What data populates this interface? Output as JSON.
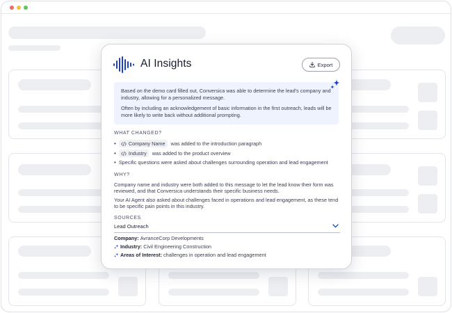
{
  "insights": {
    "title": "AI Insights",
    "export_label": "Export",
    "summary": [
      "Based on the demo card filled out, Conversica was able to determine the lead’s company and industry, allowing for a personalized message.",
      "Often by including an acknowledgement of basic information in the first outreach, leads will be more likely to write back without additional prompting."
    ],
    "what_changed_heading": "WHAT CHANGED?",
    "changes": [
      {
        "chip": "Company Name",
        "text": "was added to the introduction paragraph"
      },
      {
        "chip": "Industry",
        "text": "was added to the product overview"
      },
      {
        "chip": "",
        "text": "Specific questions were asked about challenges surrounding operation and lead engagement"
      }
    ],
    "why_heading": "WHY?",
    "why_paragraphs": [
      "Company name and industry were both added to this message to let the lead know their form was reviewed, and that Conversica understands their specific business needs.",
      "Your AI Agent also asked about challenges faced in operations and lead engagement, as these tend to be specific pain points in this industry."
    ],
    "sources_heading": "SOURCES",
    "sources_dropdown": "Lead Outreach",
    "sources": [
      {
        "label": "Company:",
        "value": "AvranceCorp Developments",
        "icon": ""
      },
      {
        "label": "Industry:",
        "value": "Civil Engineering Construction",
        "icon": "sparkle-icon"
      },
      {
        "label": "Areas of Interest:",
        "value": "challenges in operation and lead engagement",
        "icon": "sparkle-icon"
      }
    ]
  },
  "colors": {
    "accent": "#1c3fc9",
    "summary_bg": "#eef3fd",
    "skeleton": "#eceef2"
  }
}
